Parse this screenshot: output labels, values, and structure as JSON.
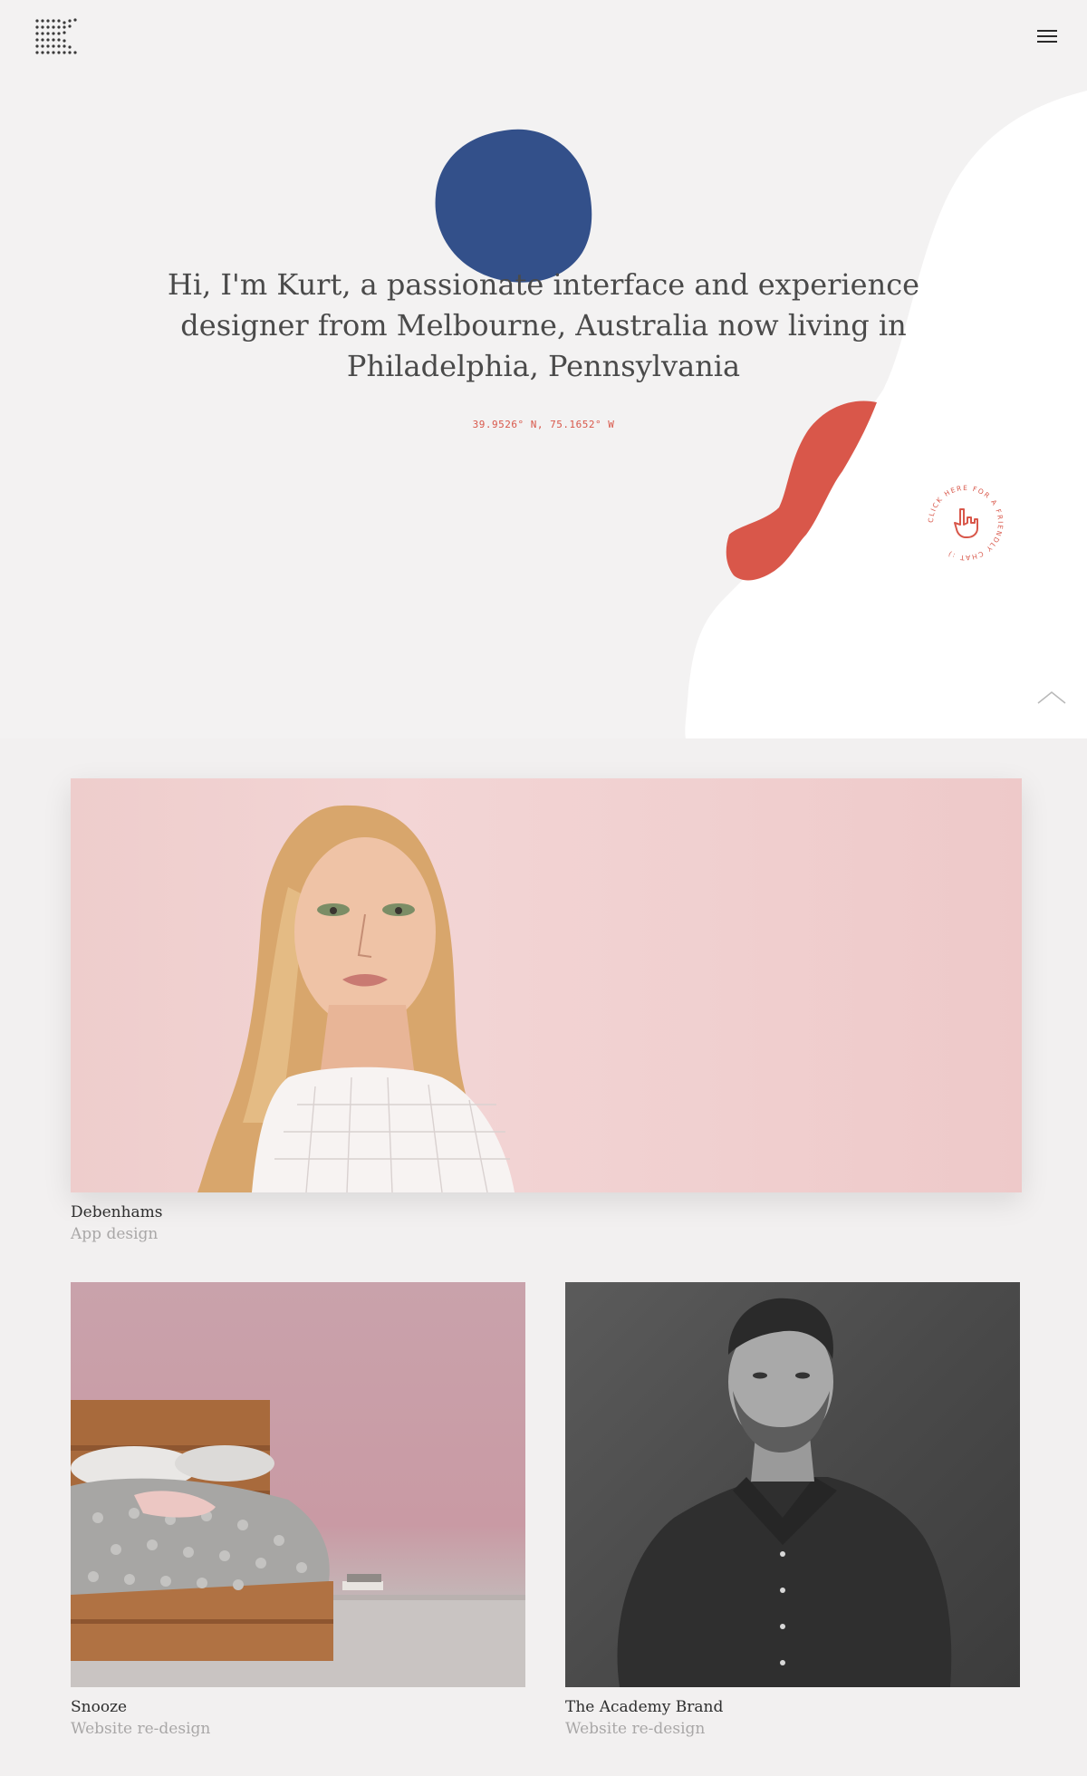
{
  "header": {
    "logo_icon": "dot-grid-logo-icon",
    "menu_icon": "hamburger-menu-icon"
  },
  "hero": {
    "intro": "Hi, I'm Kurt, a passionate interface and experience designer from Melbourne, Australia now living in Philadelphia, Pennsylvania",
    "coordinates": "39.9526° N, 75.1652° W",
    "chat_badge": {
      "text": "CLICK HERE FOR A FRIENDLY CHAT :)",
      "icon": "pointing-hand-icon"
    },
    "scroll_up_icon": "chevron-up-icon",
    "colors": {
      "blue_blob": "#33508a",
      "red_blob": "#d9574a",
      "white_blob": "#ffffff",
      "accent_text": "#d8574a"
    }
  },
  "projects": [
    {
      "name": "Debenhams",
      "category": "App design"
    },
    {
      "name": "Snooze",
      "category": "Website re-design"
    },
    {
      "name": "The Academy Brand",
      "category": "Website re-design"
    }
  ]
}
